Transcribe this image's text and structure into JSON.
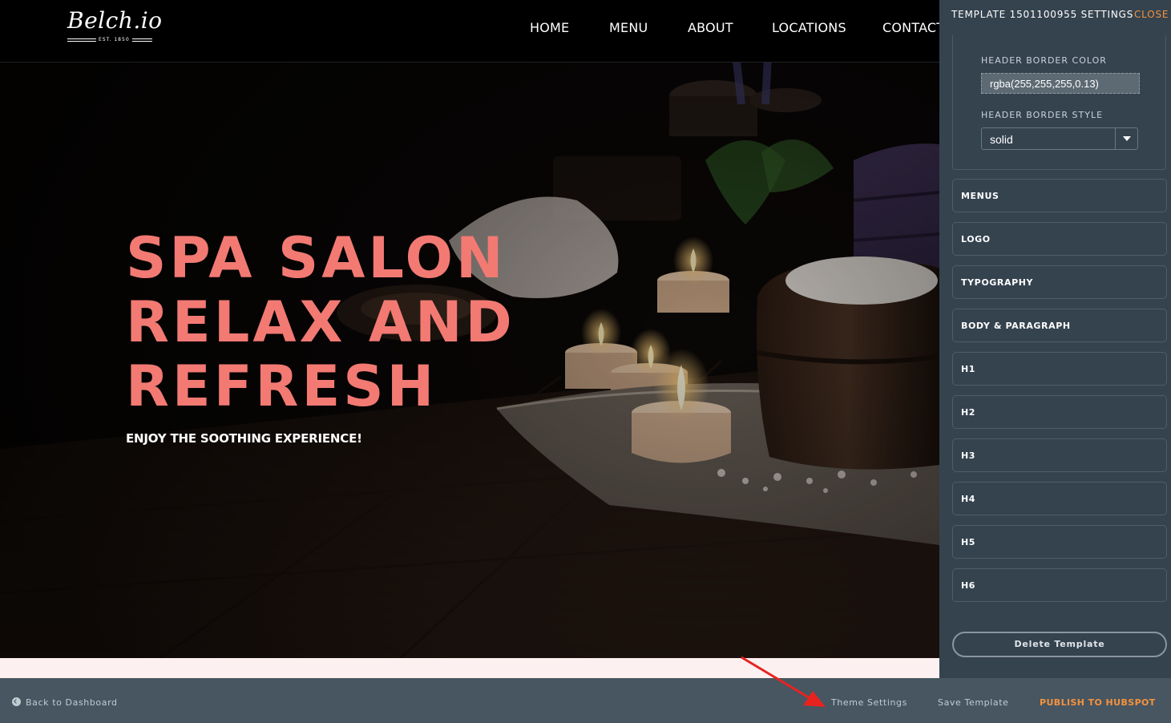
{
  "site": {
    "logo_text": "Belch.io",
    "logo_est": "EST. 1850",
    "nav": [
      "HOME",
      "MENU",
      "ABOUT",
      "LOCATIONS",
      "CONTACT"
    ]
  },
  "hero": {
    "lines": [
      "SPA SALON",
      "RELAX AND",
      "REFRESH"
    ],
    "subtitle": "ENJOY THE SOOTHING EXPERIENCE!"
  },
  "panel": {
    "title": "TEMPLATE 1501100955 SETTINGS",
    "close_label": "CLOSE",
    "header_border_color_label": "HEADER BORDER COLOR",
    "header_border_color_value": "rgba(255,255,255,0.13)",
    "header_border_style_label": "HEADER BORDER STYLE",
    "header_border_style_value": "solid",
    "sections": [
      "MENUS",
      "LOGO",
      "TYPOGRAPHY",
      "BODY & PARAGRAPH",
      "H1",
      "H2",
      "H3",
      "H4",
      "H5",
      "H6"
    ],
    "delete_label": "Delete Template"
  },
  "bottom_bar": {
    "back_label": "Back to Dashboard",
    "theme_settings_label": "Theme Settings",
    "save_label": "Save Template",
    "publish_label": "PUBLISH TO HUBSPOT"
  },
  "colors": {
    "hero_heading": "#f27a73",
    "accent_orange": "#f5923e",
    "panel_bg": "#35434f",
    "bottom_bar_bg": "#475661",
    "annotation_arrow": "#e8231f"
  },
  "icons": {
    "back": "circle-arrow-left-icon",
    "select": "caret-down-icon"
  }
}
